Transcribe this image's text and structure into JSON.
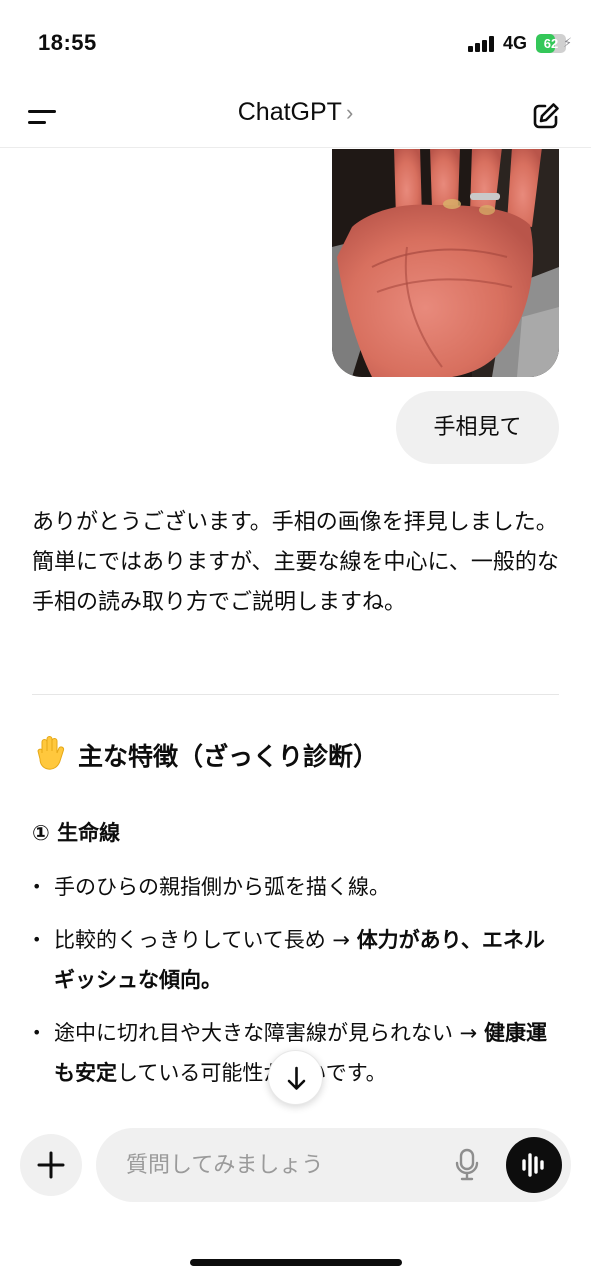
{
  "status_bar": {
    "time": "18:55",
    "network": "4G",
    "battery_level": "62",
    "battery_fraction": 0.62,
    "battery_color": "#34c759"
  },
  "nav": {
    "title": "ChatGPT",
    "title_chevron": "›",
    "menu_icon": "menu-icon",
    "compose_icon": "compose-icon"
  },
  "messages": {
    "user_image_alt": "palm-photo",
    "user_text": "手相見て",
    "assistant_intro": "ありがとうございます。手相の画像を拝見しました。簡単にではありますが、主要な線を中心に、一般的な手相の読み取り方でご説明しますね。",
    "section_title": "主な特徴（ざっくり診断）",
    "section_icon": "raised-hand-emoji",
    "subsection_title": "① 生命線",
    "bullets": [
      {
        "plain": "手のひらの親指側から弧を描く線。",
        "bold": "",
        "tail": ""
      },
      {
        "plain": "比較的くっきりしていて長め → ",
        "bold": "体力があり、エネルギッシュな傾向。",
        "tail": ""
      },
      {
        "plain": "途中に切れ目や大きな障害線が見られない → ",
        "bold": "健康運も安定",
        "tail": "している可能性が高いです。"
      }
    ]
  },
  "composer": {
    "placeholder": "質問してみましょう",
    "plus_icon": "plus-icon",
    "mic_icon": "microphone-icon",
    "voice_icon": "voice-waveform-icon"
  },
  "scroll_icon": "arrow-down-icon"
}
